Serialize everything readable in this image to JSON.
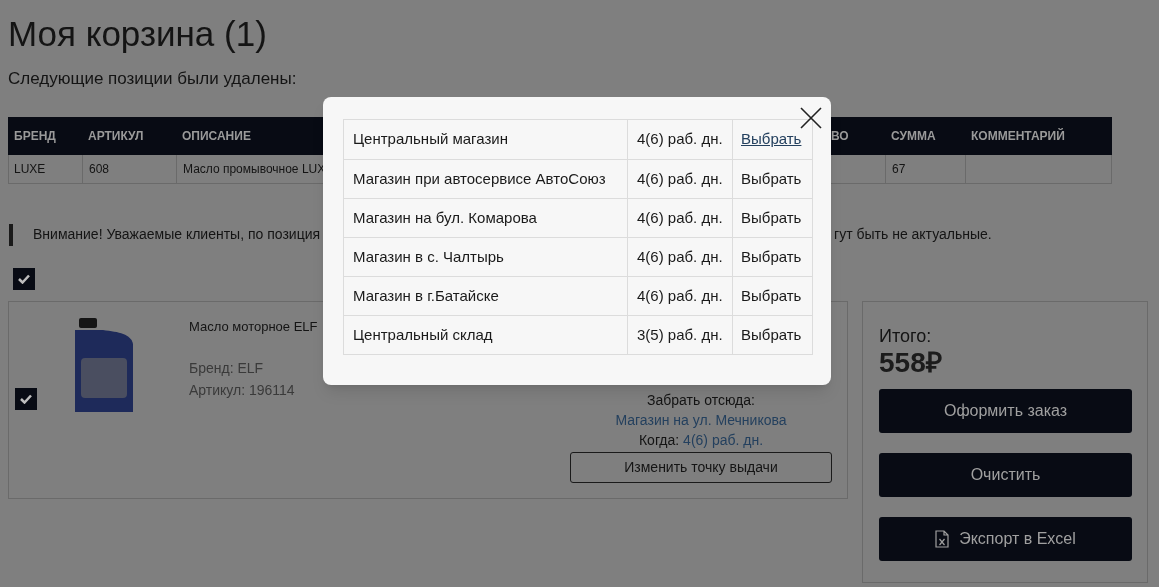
{
  "page": {
    "title": "Моя корзина (1)",
    "removed_notice": "Следующие позиции были удалены:"
  },
  "removed_table": {
    "columns": [
      "БРЕНД",
      "АРТИКУЛ",
      "ОПИСАНИЕ",
      "ВО",
      "СУММА",
      "КОММЕНТАРИЙ"
    ],
    "rows": [
      {
        "brand": "LUXE",
        "article": "608",
        "description": "Масло промывочное LUX",
        "sum": "67"
      }
    ]
  },
  "warning": {
    "text_start": "Внимание! Уважаемые клиенты, по позиция",
    "text_end": "гут быть не актуальные."
  },
  "select_all": {
    "checked": true
  },
  "cart_item": {
    "checked": true,
    "name": "Масло моторное ELF",
    "brand": "Бренд: ELF",
    "article": "Артикул: 196114",
    "pickup_label": "Забрать отсюда:",
    "pickup_store": "Магазин на ул. Мечникова",
    "when_label": "Когда:",
    "when_value": "4(6) раб. дн.",
    "change_button": "Изменить точку выдачи"
  },
  "summary": {
    "total_label": "Итого:",
    "total": "558₽",
    "buttons": [
      {
        "label": "Оформить заказ",
        "kind": "plain"
      },
      {
        "label": "Очистить",
        "kind": "plain"
      },
      {
        "label": "Экспорт в Excel",
        "kind": "export"
      }
    ]
  },
  "pickup_modal": {
    "stores": [
      {
        "name": "Центральный магазин",
        "days": "4(6) раб. дн.",
        "action": "Выбрать",
        "hovered": true
      },
      {
        "name": "Магазин при автосервисе АвтоСоюз",
        "days": "4(6) раб. дн.",
        "action": "Выбрать",
        "hovered": false
      },
      {
        "name": "Магазин на бул. Комарова",
        "days": "4(6) раб. дн.",
        "action": "Выбрать",
        "hovered": false
      },
      {
        "name": "Магазин в с. Чалтырь",
        "days": "4(6) раб. дн.",
        "action": "Выбрать",
        "hovered": false
      },
      {
        "name": "Магазин в г.Батайске",
        "days": "4(6) раб. дн.",
        "action": "Выбрать",
        "hovered": false
      },
      {
        "name": "Центральный склад",
        "days": "3(5) раб. дн.",
        "action": "Выбрать",
        "hovered": false
      }
    ]
  }
}
